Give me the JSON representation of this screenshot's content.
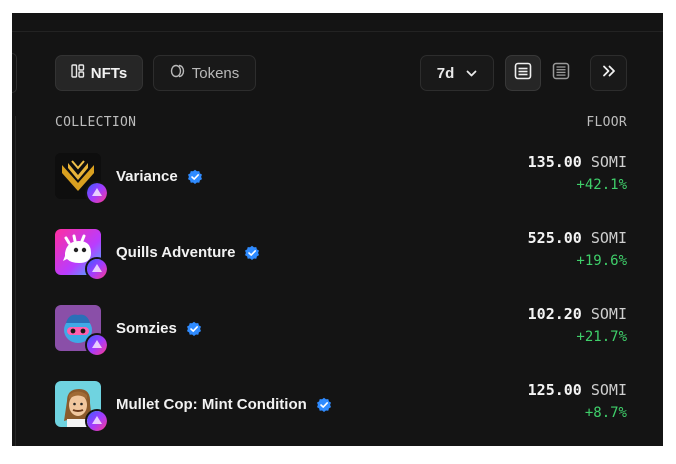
{
  "tabs": [
    {
      "label": "NFTs",
      "icon": "grid-icon",
      "active": true
    },
    {
      "label": "Tokens",
      "icon": "coin-icon",
      "active": false
    }
  ],
  "controls": {
    "range_label": "7d",
    "range_icon": "chevron-down-icon",
    "view_icons": [
      "list-view-icon",
      "compact-view-icon"
    ],
    "expand_icon": "double-chevron-right-icon"
  },
  "table": {
    "columns": [
      "COLLECTION",
      "FLOOR"
    ],
    "rows": [
      {
        "name": "Variance",
        "floor": "135.00",
        "currency": "SOMI",
        "change": "+42.1%"
      },
      {
        "name": "Quills Adventure",
        "floor": "525.00",
        "currency": "SOMI",
        "change": "+19.6%"
      },
      {
        "name": "Somzies",
        "floor": "102.20",
        "currency": "SOMI",
        "change": "+21.7%"
      },
      {
        "name": "Mullet Cop: Mint Condition",
        "floor": "125.00",
        "currency": "SOMI",
        "change": "+8.7%"
      }
    ]
  },
  "colors": {
    "background": "#141414",
    "positive": "#3fcf6a",
    "verified": "#2f8bff",
    "variance_gold": "#d9a020"
  }
}
